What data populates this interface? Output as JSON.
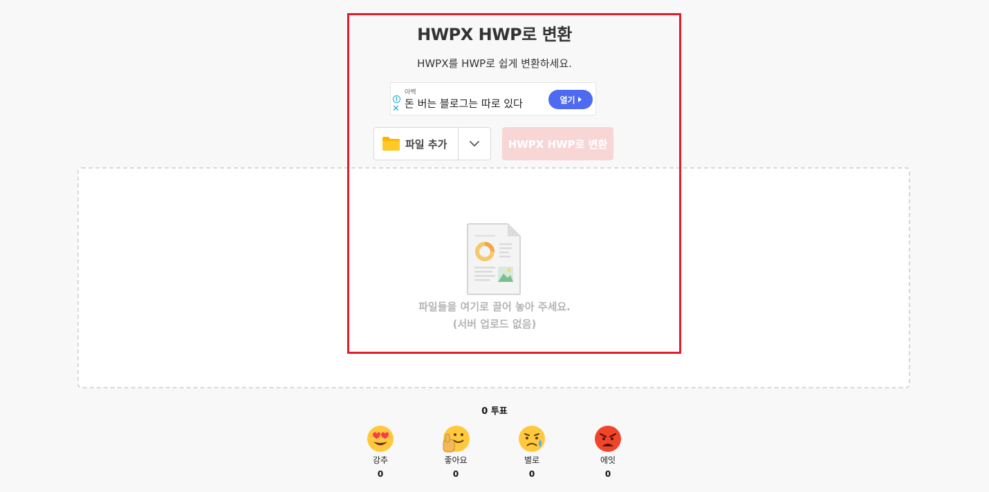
{
  "header": {
    "title": "HWPX HWP로 변환",
    "subtitle": "HWPX를 HWP로 쉽게 변환하세요."
  },
  "ad": {
    "brand": "아백",
    "text": "돈 버는 블로그는 따로 있다",
    "open_label": "열기",
    "info_glyph": "i",
    "close_glyph": "✕"
  },
  "toolbar": {
    "add_file_label": "파일 추가",
    "convert_label": "HWPX HWP로 변환"
  },
  "dropzone": {
    "line1": "파일들을 여기로 끌어 놓아 주세요.",
    "line2": "(서버 업로드 없음)"
  },
  "rating": {
    "total_votes": "0 투표",
    "reactions": [
      {
        "label": "강추",
        "count": "0",
        "icon": "heart-eyes-emoji-icon"
      },
      {
        "label": "좋아요",
        "count": "0",
        "icon": "thumbs-up-emoji-icon"
      },
      {
        "label": "별로",
        "count": "0",
        "icon": "sad-emoji-icon"
      },
      {
        "label": "에잇",
        "count": "0",
        "icon": "angry-emoji-icon"
      }
    ]
  },
  "colors": {
    "highlight_border": "#e31b2b",
    "convert_disabled_bg": "#f8d6d6",
    "ad_button": "#4d6af1",
    "folder": "#ffc107"
  }
}
